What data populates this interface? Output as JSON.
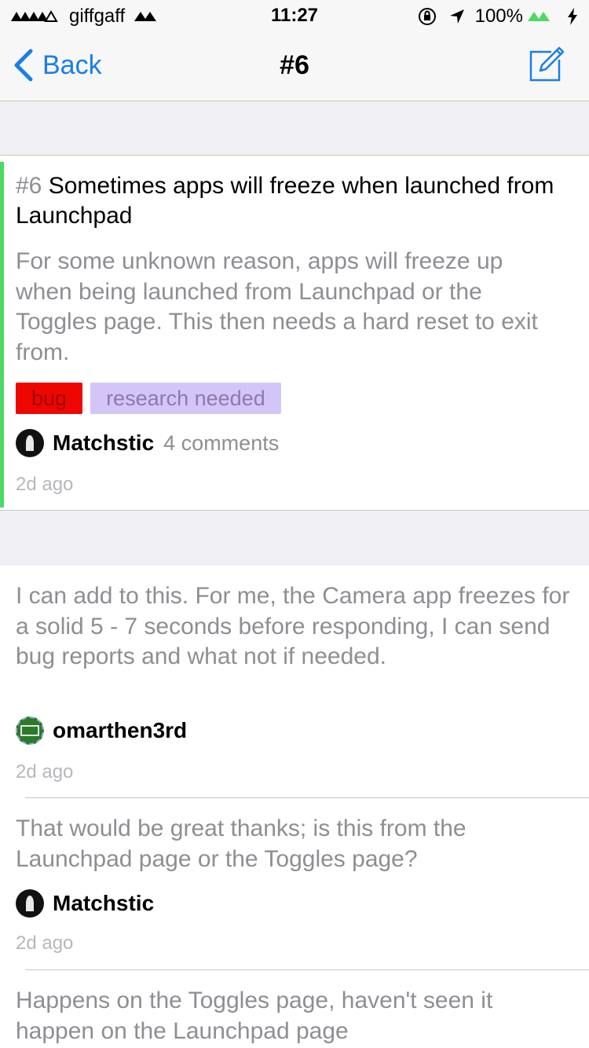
{
  "status": {
    "carrier": "giffgaff",
    "time": "11:27",
    "battery": "100%"
  },
  "nav": {
    "back_label": "Back",
    "title": "#6",
    "compose_icon": "compose-icon"
  },
  "issue": {
    "number": "#6",
    "title": "Sometimes apps will freeze when launched from Launchpad",
    "body": "For some unknown reason, apps will freeze up when being launched from Launchpad or the Toggles page. This then needs a hard reset to exit from.",
    "labels": [
      {
        "name": "bug",
        "color": "#ee0701"
      },
      {
        "name": "research needed",
        "color": "#d4c5f9"
      }
    ],
    "author": "Matchstic",
    "comments": "4 comments",
    "time": "2d ago",
    "accent_color": "#4cd964"
  },
  "comments": [
    {
      "body": "I can add to this. For me, the Camera app freezes for a solid 5 - 7 seconds before responding, I can send bug reports and what not if needed.",
      "author": "omarthen3rd",
      "time": "2d ago"
    },
    {
      "body": "That would be great thanks; is this from the Launchpad page or the Toggles page?",
      "author": "Matchstic",
      "time": "2d ago"
    },
    {
      "body": "Happens on the Toggles page, haven't seen it happen on the Launchpad page",
      "author": "",
      "time": ""
    }
  ]
}
